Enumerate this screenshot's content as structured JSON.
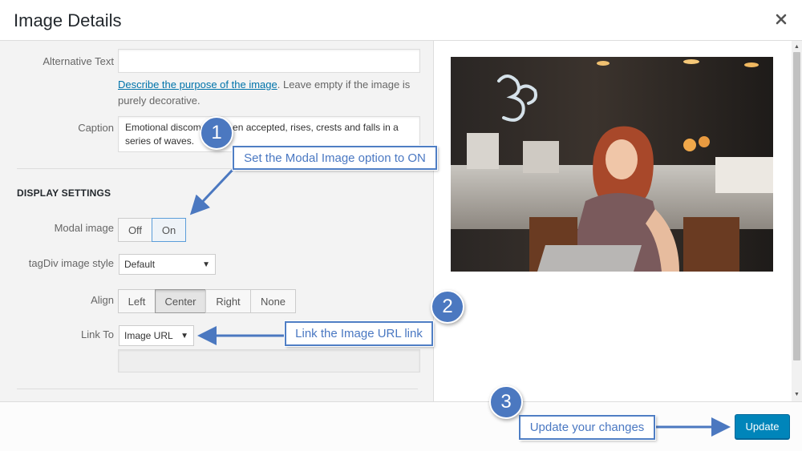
{
  "dialog": {
    "title": "Image Details",
    "close_icon": "close-icon"
  },
  "form": {
    "alt_text": {
      "label": "Alternative Text",
      "value": "",
      "help_link": "Describe the purpose of the image",
      "help_rest": ". Leave empty if the image is purely decorative."
    },
    "caption": {
      "label": "Caption",
      "value": "Emotional discomfort, when accepted, rises, crests and falls in a series of waves."
    },
    "display_settings": {
      "title": "DISPLAY SETTINGS",
      "modal_image": {
        "label": "Modal image",
        "options": [
          "Off",
          "On"
        ],
        "selected": "On"
      },
      "tagdiv_style": {
        "label": "tagDiv image style",
        "value": "Default"
      },
      "align": {
        "label": "Align",
        "options": [
          "Left",
          "Center",
          "Right",
          "None"
        ],
        "selected": "Center"
      },
      "link_to": {
        "label": "Link To",
        "value": "Image URL",
        "url_value": ""
      }
    }
  },
  "footer": {
    "update_label": "Update"
  },
  "annotations": [
    {
      "number": "1",
      "text": "Set the Modal Image option to ON"
    },
    {
      "number": "2",
      "text": "Link the Image URL link"
    },
    {
      "number": "3",
      "text": "Update your changes"
    }
  ],
  "colors": {
    "accent": "#0085ba",
    "callout": "#4a78c2"
  }
}
